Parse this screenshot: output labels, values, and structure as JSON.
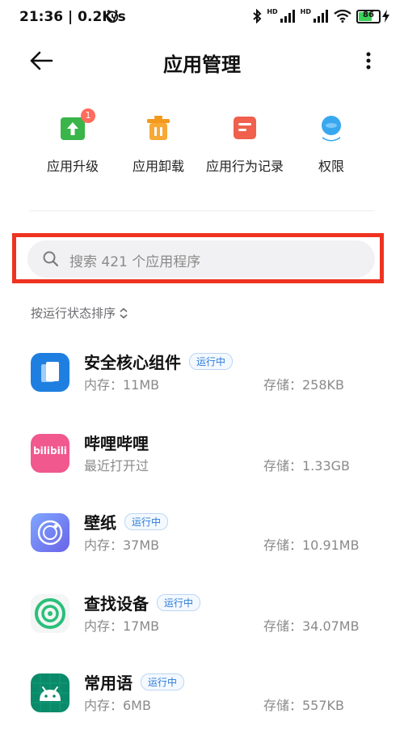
{
  "status": {
    "time_speed": "21:36 | 0.2K/s",
    "hd1": "HD",
    "hd2": "HD",
    "battery": "86"
  },
  "header": {
    "title": "应用管理"
  },
  "quick_actions": [
    {
      "label": "应用升级",
      "badge": "1"
    },
    {
      "label": "应用卸载"
    },
    {
      "label": "应用行为记录"
    },
    {
      "label": "权限"
    }
  ],
  "search": {
    "placeholder": "搜索 421 个应用程序"
  },
  "sort": {
    "label": "按运行状态排序"
  },
  "apps": [
    {
      "name": "安全核心组件",
      "status": "运行中",
      "sub": "内存：11MB",
      "storage": "存储：258KB"
    },
    {
      "name": "哔哩哔哩",
      "status": "",
      "sub": "最近打开过",
      "storage": "存储：1.33GB",
      "icon_text": "bilibili"
    },
    {
      "name": "壁纸",
      "status": "运行中",
      "sub": "内存：37MB",
      "storage": "存储：10.91MB"
    },
    {
      "name": "查找设备",
      "status": "运行中",
      "sub": "内存：17MB",
      "storage": "存储：34.07MB"
    },
    {
      "name": "常用语",
      "status": "运行中",
      "sub": "内存：6MB",
      "storage": "存储：557KB"
    }
  ],
  "colors": {
    "accent_red": "#ee3320",
    "running_blue": "#2a7bd8"
  }
}
